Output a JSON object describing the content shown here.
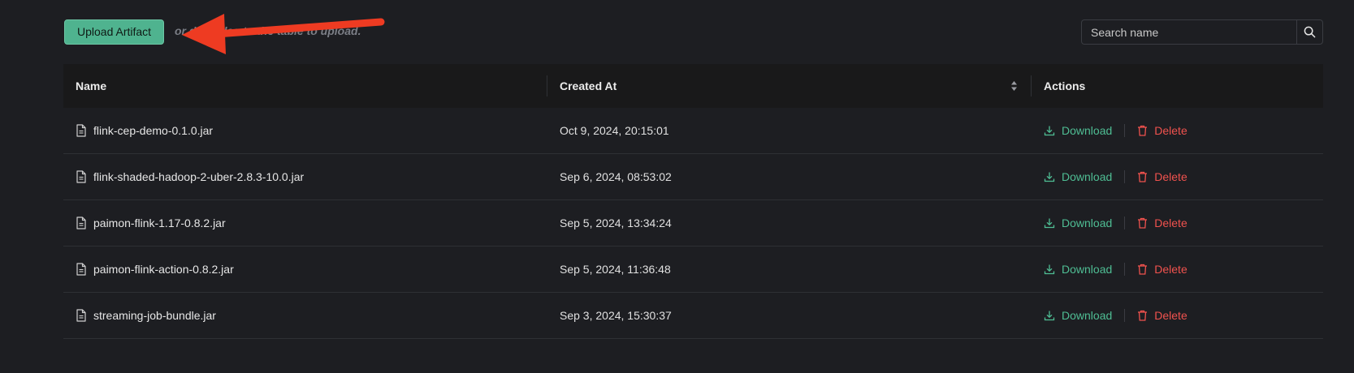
{
  "toolbar": {
    "upload_label": "Upload Artifact",
    "hint": "or drag files to the table to upload."
  },
  "search": {
    "placeholder": "Search name",
    "icon": "search-icon"
  },
  "table": {
    "columns": [
      "Name",
      "Created At",
      "Actions"
    ],
    "rows": [
      {
        "name": "flink-cep-demo-0.1.0.jar",
        "created": "Oct 9, 2024, 20:15:01",
        "download": "Download",
        "delete": "Delete"
      },
      {
        "name": "flink-shaded-hadoop-2-uber-2.8.3-10.0.jar",
        "created": "Sep 6, 2024, 08:53:02",
        "download": "Download",
        "delete": "Delete"
      },
      {
        "name": "paimon-flink-1.17-0.8.2.jar",
        "created": "Sep 5, 2024, 13:34:24",
        "download": "Download",
        "delete": "Delete"
      },
      {
        "name": "paimon-flink-action-0.8.2.jar",
        "created": "Sep 5, 2024, 11:36:48",
        "download": "Download",
        "delete": "Delete"
      },
      {
        "name": "streaming-job-bundle.jar",
        "created": "Sep 3, 2024, 15:30:37",
        "download": "Download",
        "delete": "Delete"
      }
    ]
  },
  "colors": {
    "accent": "#4fb38f",
    "download": "#4fbe94",
    "delete": "#f0524e",
    "annotation_arrow": "#ee3b22",
    "background": "#1d1e22"
  }
}
